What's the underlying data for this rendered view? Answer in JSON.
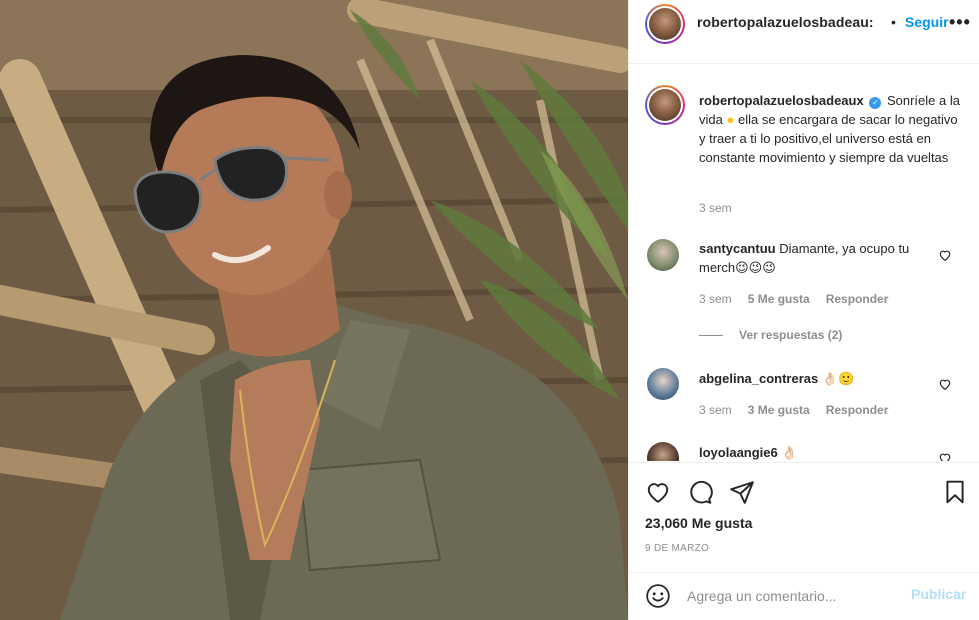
{
  "photo": {
    "description_icon": "post-photo"
  },
  "header": {
    "username": "robertopalazuelosbadeau:",
    "separator": "•",
    "follow_label": "Seguir",
    "more_label": "•••"
  },
  "caption": {
    "username": "robertopalazuelosbadeaux",
    "text_part1": "Sonríele a la vida",
    "text_part2": "ella se encargara de sacar lo negativo y traer a ti lo positivo,el universo está en constante movimiento y siempre da vueltas",
    "time": "3 sem"
  },
  "comments": [
    {
      "username": "santycantuu",
      "text": "Diamante, ya ocupo tu merch😉😉😉",
      "time": "3 sem",
      "likes": "5 Me gusta",
      "reply": "Responder",
      "view_replies": "Ver respuestas (2)"
    },
    {
      "username": "abgelina_contreras",
      "text": "👌🏻🙂",
      "time": "3 sem",
      "likes": "3 Me gusta",
      "reply": "Responder"
    },
    {
      "username": "loyolaangie6",
      "text": "👌🏻"
    }
  ],
  "actions": {
    "likes": "23,060 Me gusta",
    "date": "9 DE MARZO"
  },
  "add_comment": {
    "placeholder": "Agrega un comentario...",
    "post_label": "Publicar"
  },
  "colors": {
    "accent": "#0095f6",
    "muted": "#8e8e8e",
    "text": "#262626",
    "verified": "#3897f0",
    "post_disabled": "#b2dffc"
  },
  "icons": [
    "heart-icon",
    "comment-icon",
    "share-icon",
    "bookmark-icon",
    "emoji-icon",
    "verified-icon",
    "more-icon"
  ]
}
